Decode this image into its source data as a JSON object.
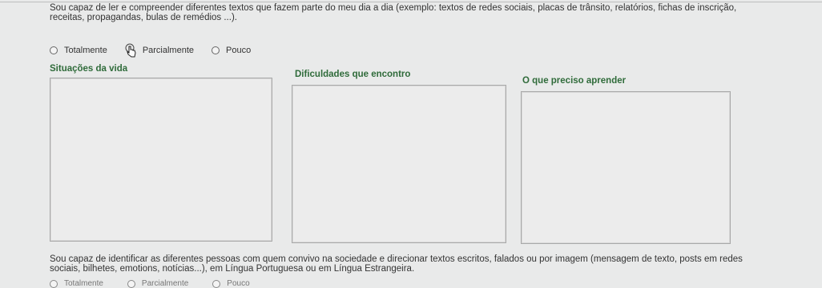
{
  "question_1": {
    "text": "Sou capaz de ler e compreender diferentes textos que fazem parte do meu dia a dia (exemplo: textos de redes sociais, placas de trânsito, relatórios, fichas de inscrição, receitas, propagandas, bulas de remédios ...).",
    "options": [
      "Totalmente",
      "Parcialmente",
      "Pouco"
    ]
  },
  "sections": {
    "col1": "Situações da vida",
    "col2": "Dificuldades que encontro",
    "col3": "O que preciso aprender"
  },
  "question_2": {
    "text": "Sou capaz de identificar as diferentes pessoas com quem convivo na sociedade e direcionar textos escritos, falados ou por imagem (mensagem de texto, posts em redes sociais, bilhetes, emotions, notícias...), em Língua Portuguesa ou em Língua Estrangeira.",
    "options": [
      "Totalmente",
      "Parcialmente",
      "Pouco"
    ]
  },
  "colors": {
    "label_green": "#2f6b3a",
    "background": "#e9eaea"
  },
  "icons": [
    "radio-circle",
    "hand-pointer-cursor-icon"
  ]
}
